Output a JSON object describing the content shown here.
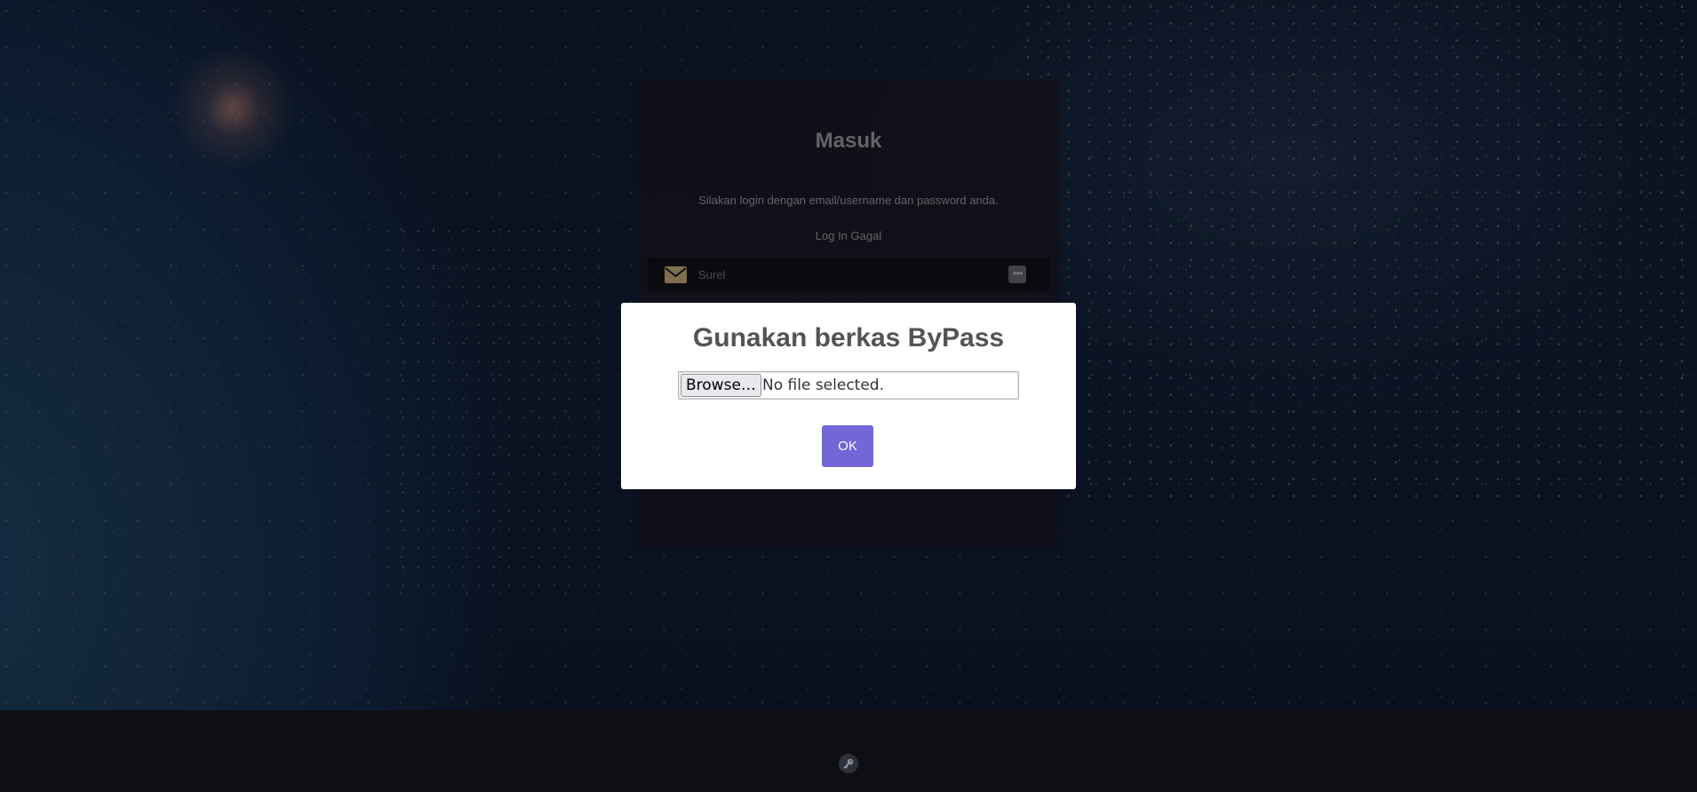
{
  "login": {
    "title": "Masuk",
    "subtitle": "Silakan login dengan email/username dan password anda.",
    "error": "Log In Gagal",
    "email_label": "Surel",
    "more_label": "•••"
  },
  "modal": {
    "title": "Gunakan berkas ByPass",
    "browse_label": "Browse…",
    "file_status": "No file selected.",
    "ok_label": "OK"
  },
  "colors": {
    "ok_button": "#7367d8",
    "mail_icon": "#b09a6a"
  },
  "icons": {
    "mail": "envelope-icon",
    "more": "more-icon",
    "footer": "key-icon"
  }
}
